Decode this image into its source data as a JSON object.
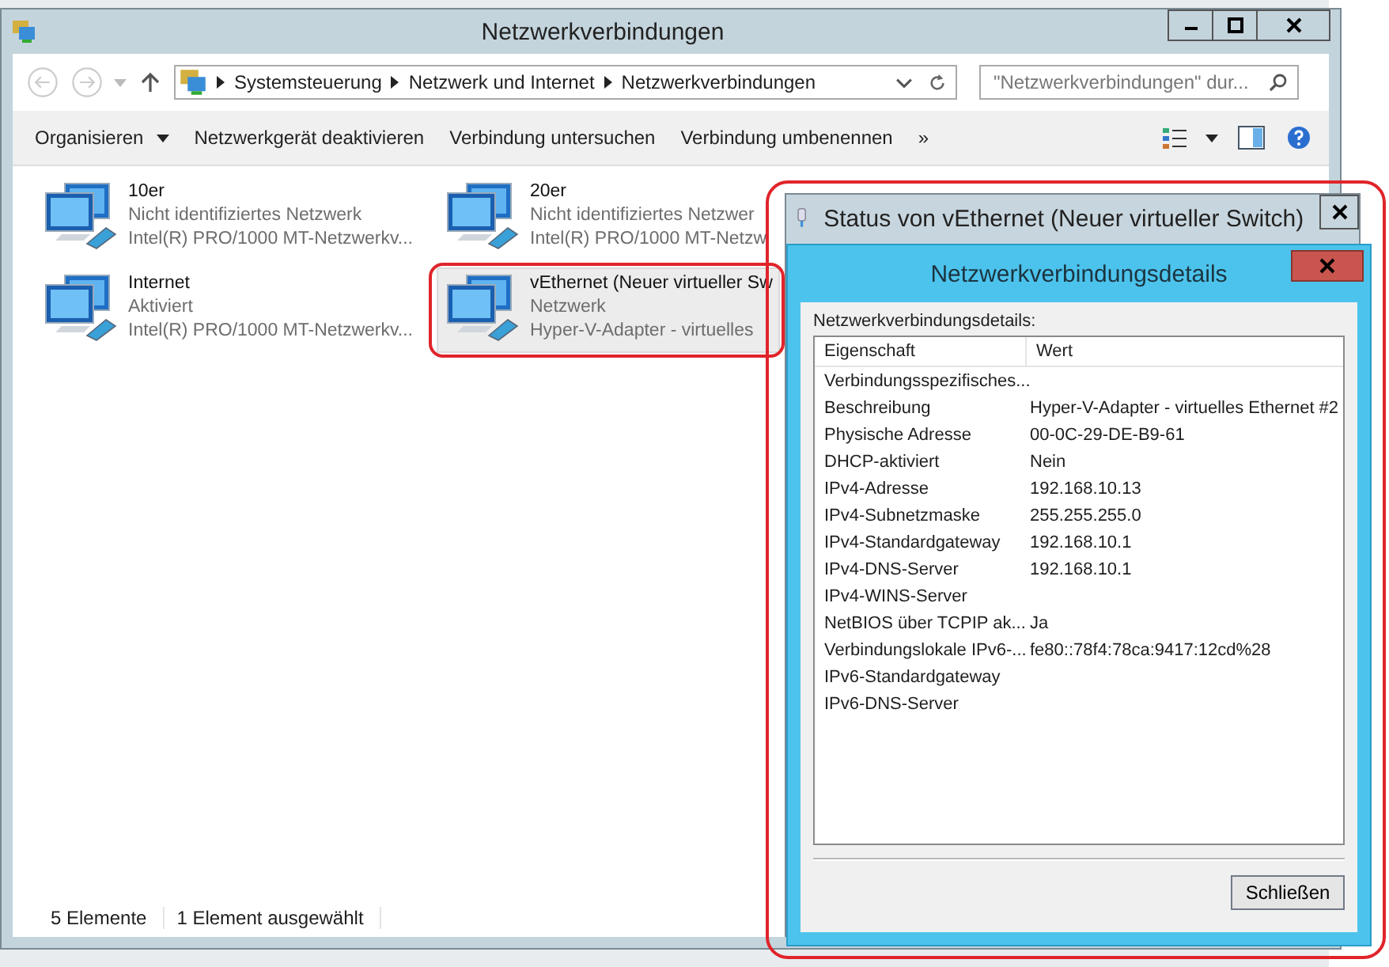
{
  "window": {
    "title": "Netzwerkverbindungen"
  },
  "address_bar": {
    "path": [
      "Systemsteuerung",
      "Netzwerk und Internet",
      "Netzwerkverbindungen"
    ]
  },
  "search": {
    "placeholder": "\"Netzwerkverbindungen\" dur..."
  },
  "toolbar": {
    "commands": [
      "Organisieren",
      "Netzwerkgerät deaktivieren",
      "Verbindung untersuchen",
      "Verbindung umbenennen",
      "»"
    ]
  },
  "connections": [
    {
      "name": "10er",
      "status": "Nicht identifiziertes Netzwerk",
      "adapter": "Intel(R) PRO/1000 MT-Netzwerkv...",
      "selected": false,
      "circled": false
    },
    {
      "name": "20er",
      "status": "Nicht identifiziertes Netzwer",
      "adapter": "Intel(R) PRO/1000 MT-Netzw",
      "selected": false,
      "circled": false
    },
    {
      "name": "Internet",
      "status": "Aktiviert",
      "adapter": "Intel(R) PRO/1000 MT-Netzwerkv...",
      "selected": false,
      "circled": false
    },
    {
      "name": "vEthernet (Neuer virtueller Sw",
      "status": "Netzwerk",
      "adapter": "Hyper-V-Adapter - virtuelles",
      "selected": true,
      "circled": true
    }
  ],
  "status_bar": [
    "5 Elemente",
    "1 Element ausgewählt"
  ],
  "status_dialog": {
    "title": "Status von vEthernet (Neuer virtueller Switch)",
    "circled": true
  },
  "details_dialog": {
    "title": "Netzwerkverbindungsdetails",
    "label": "Netzwerkverbindungsdetails:",
    "columns": [
      "Eigenschaft",
      "Wert"
    ],
    "rows": [
      [
        "Verbindungsspezifisches...",
        ""
      ],
      [
        "Beschreibung",
        "Hyper-V-Adapter - virtuelles Ethernet #2"
      ],
      [
        "Physische Adresse",
        "00-0C-29-DE-B9-61"
      ],
      [
        "DHCP-aktiviert",
        "Nein"
      ],
      [
        "IPv4-Adresse",
        "192.168.10.13"
      ],
      [
        "IPv4-Subnetzmaske",
        "255.255.255.0"
      ],
      [
        "IPv4-Standardgateway",
        "192.168.10.1"
      ],
      [
        "IPv4-DNS-Server",
        "192.168.10.1"
      ],
      [
        "IPv4-WINS-Server",
        ""
      ],
      [
        "NetBIOS über TCPIP ak...",
        "Ja"
      ],
      [
        "Verbindungslokale IPv6-...",
        "fe80::78f4:78ca:9417:12cd%28"
      ],
      [
        "IPv6-Standardgateway",
        ""
      ],
      [
        "IPv6-DNS-Server",
        ""
      ]
    ],
    "button": "Schließen"
  }
}
